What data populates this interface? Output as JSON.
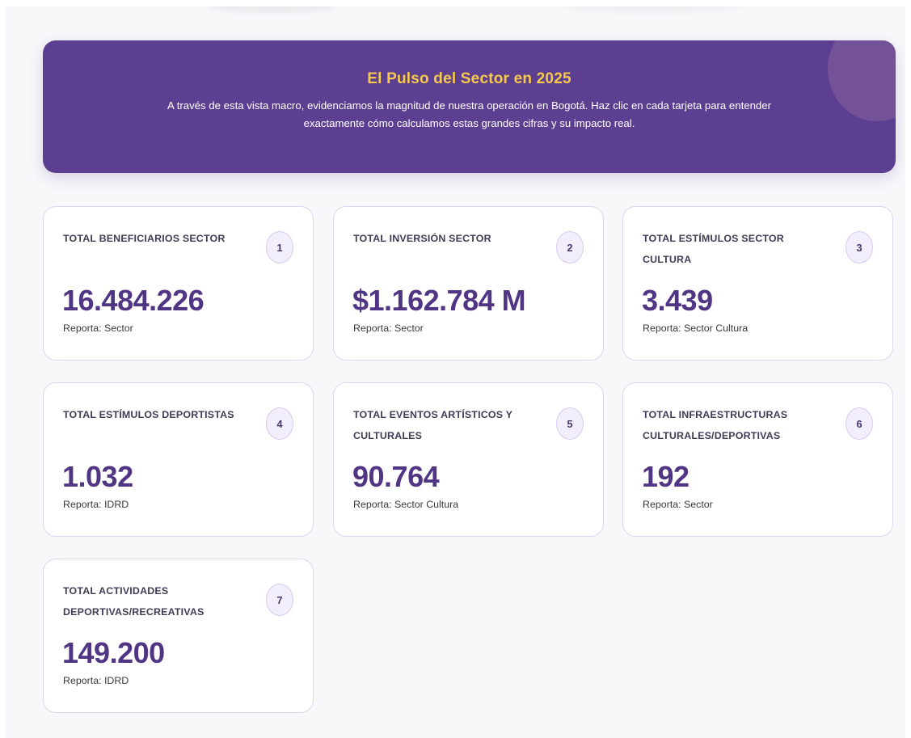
{
  "hero": {
    "title": "El Pulso del Sector en 2025",
    "description": "A través de esta vista macro, evidenciamos la magnitud de nuestra operación en Bogotá. Haz clic en cada tarjeta para entender exactamente cómo calculamos estas grandes cifras y su impacto real."
  },
  "colors": {
    "hero_bg": "#5d3f92",
    "hero_title": "#f7c948",
    "value": "#503585",
    "card_border": "#ddd6ee",
    "badge_bg": "#f3eefb"
  },
  "cards": [
    {
      "number": "1",
      "label": "TOTAL BENEFICIARIOS SECTOR",
      "value": "16.484.226",
      "source": "Reporta: Sector"
    },
    {
      "number": "2",
      "label": "TOTAL INVERSIÓN SECTOR",
      "value": "$1.162.784 M",
      "source": "Reporta: Sector"
    },
    {
      "number": "3",
      "label": "TOTAL ESTÍMULOS SECTOR CULTURA",
      "value": "3.439",
      "source": "Reporta: Sector Cultura"
    },
    {
      "number": "4",
      "label": "TOTAL ESTÍMULOS DEPORTISTAS",
      "value": "1.032",
      "source": "Reporta: IDRD"
    },
    {
      "number": "5",
      "label": "TOTAL EVENTOS ARTÍSTICOS Y CULTURALES",
      "value": "90.764",
      "source": "Reporta: Sector Cultura"
    },
    {
      "number": "6",
      "label": "TOTAL INFRAESTRUCTURAS CULTURALES/DEPORTIVAS",
      "value": "192",
      "source": "Reporta: Sector"
    },
    {
      "number": "7",
      "label": "TOTAL ACTIVIDADES DEPORTIVAS/RECREATIVAS",
      "value": "149.200",
      "source": "Reporta: IDRD"
    }
  ]
}
